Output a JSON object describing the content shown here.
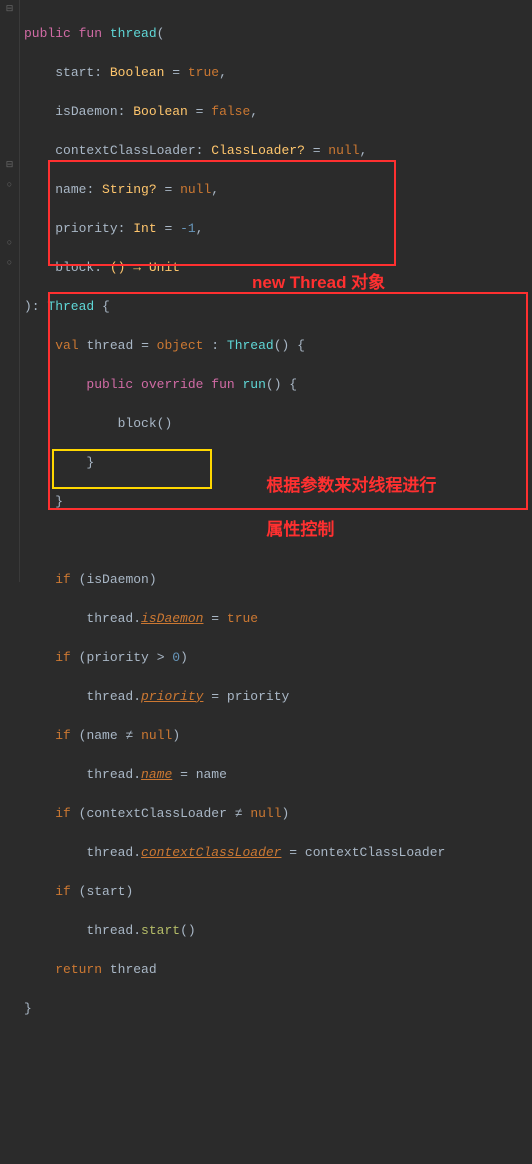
{
  "code": {
    "l1_public": "public",
    "l1_fun": "fun",
    "l1_name": "thread",
    "l1_paren": "(",
    "l2_param": "start",
    "l2_type": "Boolean",
    "l2_val": "true",
    "l3_param": "isDaemon",
    "l3_type": "Boolean",
    "l3_val": "false",
    "l4_param": "contextClassLoader",
    "l4_type": "ClassLoader?",
    "l4_val": "null",
    "l5_param": "name",
    "l5_type": "String?",
    "l5_val": "null",
    "l6_param": "priority",
    "l6_type": "Int",
    "l6_val": "-1",
    "l7_param": "block",
    "l7_type": "() → Unit",
    "l8_ret": "Thread",
    "l9_val": "val",
    "l9_thread": "thread",
    "l9_object": "object",
    "l9_type": "Thread",
    "l10_public": "public",
    "l10_override": "override",
    "l10_fun": "fun",
    "l10_run": "run",
    "l11_block": "block",
    "l14_if": "if",
    "l14_cond": "isDaemon",
    "l15_thread": "thread",
    "l15_prop": "isDaemon",
    "l15_val": "true",
    "l16_if": "if",
    "l16_cond": "priority > 0",
    "l16_priority": "priority",
    "l16_zero": "0",
    "l17_thread": "thread",
    "l17_prop": "priority",
    "l17_rhs": "priority",
    "l18_if": "if",
    "l18_cond": "name",
    "l18_null": "null",
    "l19_thread": "thread",
    "l19_prop": "name",
    "l19_rhs": "name",
    "l20_if": "if",
    "l20_cond": "contextClassLoader",
    "l20_null": "null",
    "l21_thread": "thread",
    "l21_prop": "contextClassLoader",
    "l21_rhs": "contextClassLoader",
    "l22_if": "if",
    "l22_cond": "start",
    "l23_thread": "thread",
    "l23_call": "start",
    "l24_return": "return",
    "l24_val": "thread"
  },
  "annotations": {
    "a1": "new Thread 对象",
    "a2_line1": "根据参数来对线程进行",
    "a2_line2": "属性控制"
  }
}
